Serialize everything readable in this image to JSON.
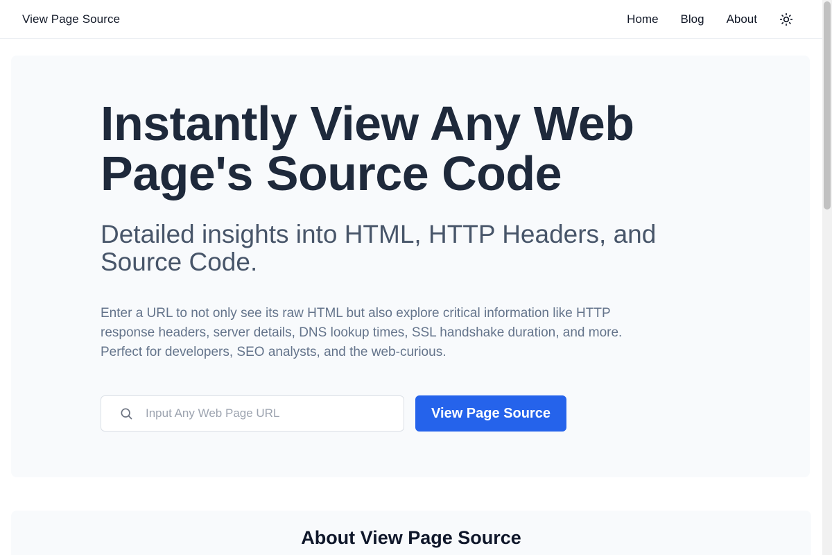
{
  "header": {
    "brand": "View Page Source",
    "nav": [
      {
        "label": "Home"
      },
      {
        "label": "Blog"
      },
      {
        "label": "About"
      }
    ],
    "theme_toggle_icon": "sun-icon"
  },
  "hero": {
    "title": "Instantly View Any Web Page's Source Code",
    "subtitle": "Detailed insights into HTML, HTTP Headers, and Source Code.",
    "description": "Enter a URL to not only see its raw HTML but also explore critical information like HTTP response headers, server details, DNS lookup times, SSL handshake duration, and more. Perfect for developers, SEO analysts, and the web-curious.",
    "search": {
      "icon": "search-icon",
      "placeholder": "Input Any Web Page URL",
      "value": ""
    },
    "cta_label": "View Page Source"
  },
  "about": {
    "title": "About View Page Source"
  },
  "colors": {
    "accent": "#2563eb",
    "hero_bg": "#f8fafc",
    "title": "#1e293b",
    "subtitle": "#475569",
    "body_text": "#64748b"
  }
}
